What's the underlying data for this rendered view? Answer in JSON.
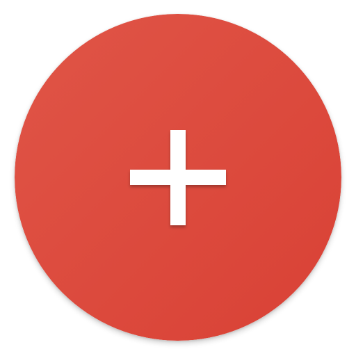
{
  "fab": {
    "icon": "plus-icon",
    "colors": {
      "fill_light": "#e05547",
      "fill_dark": "#d94135",
      "icon": "#ffffff"
    }
  }
}
